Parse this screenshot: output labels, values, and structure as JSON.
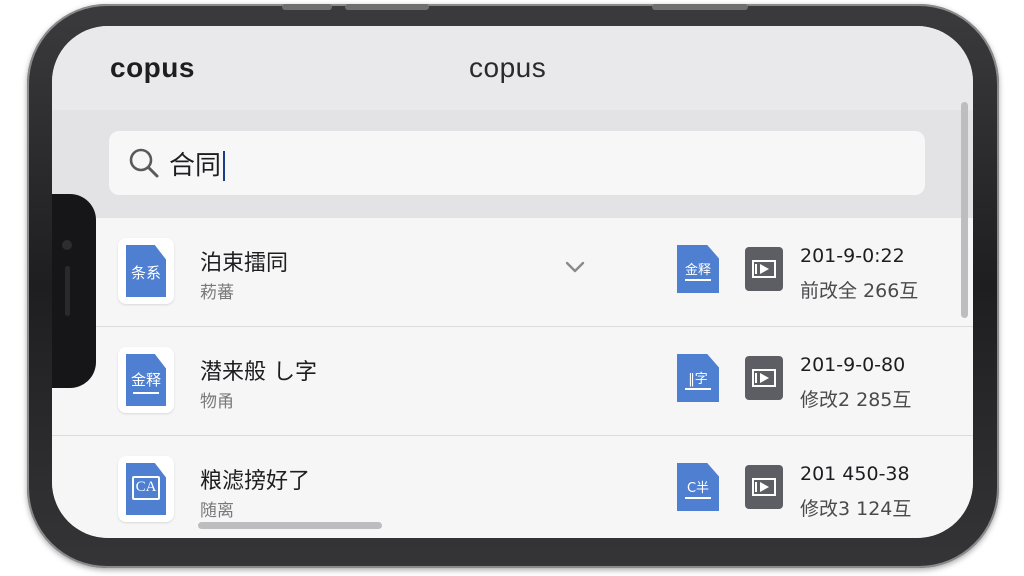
{
  "app": {
    "name": "copus",
    "header_title": "copus"
  },
  "search": {
    "value": "合同"
  },
  "files": [
    {
      "tile_text": "条系",
      "title": "泊束擂同",
      "subtitle": "菞蕃",
      "mini_text": "金释",
      "date": "201-9-0:22",
      "meta": "前改全 266互",
      "expanded": true
    },
    {
      "tile_text": "金释",
      "title": "潜来般 し字",
      "subtitle": "物甬",
      "mini_text": "‖字",
      "date": "201-9-0-80",
      "meta": "修改2 285互",
      "expanded": false
    },
    {
      "tile_text": "CA",
      "title": "粮滤搒好了",
      "subtitle": "随离",
      "mini_text": "C半",
      "date": "201 450-38",
      "meta": "修改3 124互",
      "expanded": false
    }
  ],
  "colors": {
    "doc_blue": "#4f7fd0",
    "preview_gray": "#5c5e63",
    "caret": "#1a3a8a"
  }
}
